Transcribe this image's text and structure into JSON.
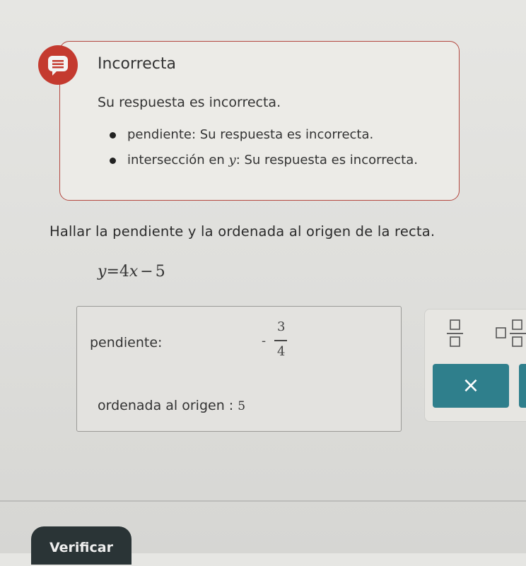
{
  "feedback": {
    "title": "Incorrecta",
    "message": "Su respuesta es incorrecta.",
    "items": [
      {
        "label": "pendiente: ",
        "text": "Su respuesta es incorrecta."
      },
      {
        "label": "intersección en ",
        "var": "y",
        "text": ": Su respuesta es incorrecta."
      }
    ],
    "accent_color": "#c43a2f"
  },
  "question": {
    "text": "Hallar la pendiente y la ordenada al origen de la recta.",
    "equation": {
      "lhs": "y",
      "eq": "=",
      "coef": "4",
      "var": "x",
      "op": "−",
      "const": "5"
    }
  },
  "answer": {
    "slope_label": "pendiente:",
    "slope_sign": "-",
    "slope_numerator": "3",
    "slope_denominator": "4",
    "intercept_label": "ordenada al origen :",
    "intercept_value": "5"
  },
  "toolbar": {
    "fraction_icon": "fraction-icon",
    "mixed_number_icon": "mixed-number-icon",
    "clear_symbol": "×",
    "button_color": "#2f7f8c"
  },
  "footer": {
    "verify_label": "Verificar"
  }
}
